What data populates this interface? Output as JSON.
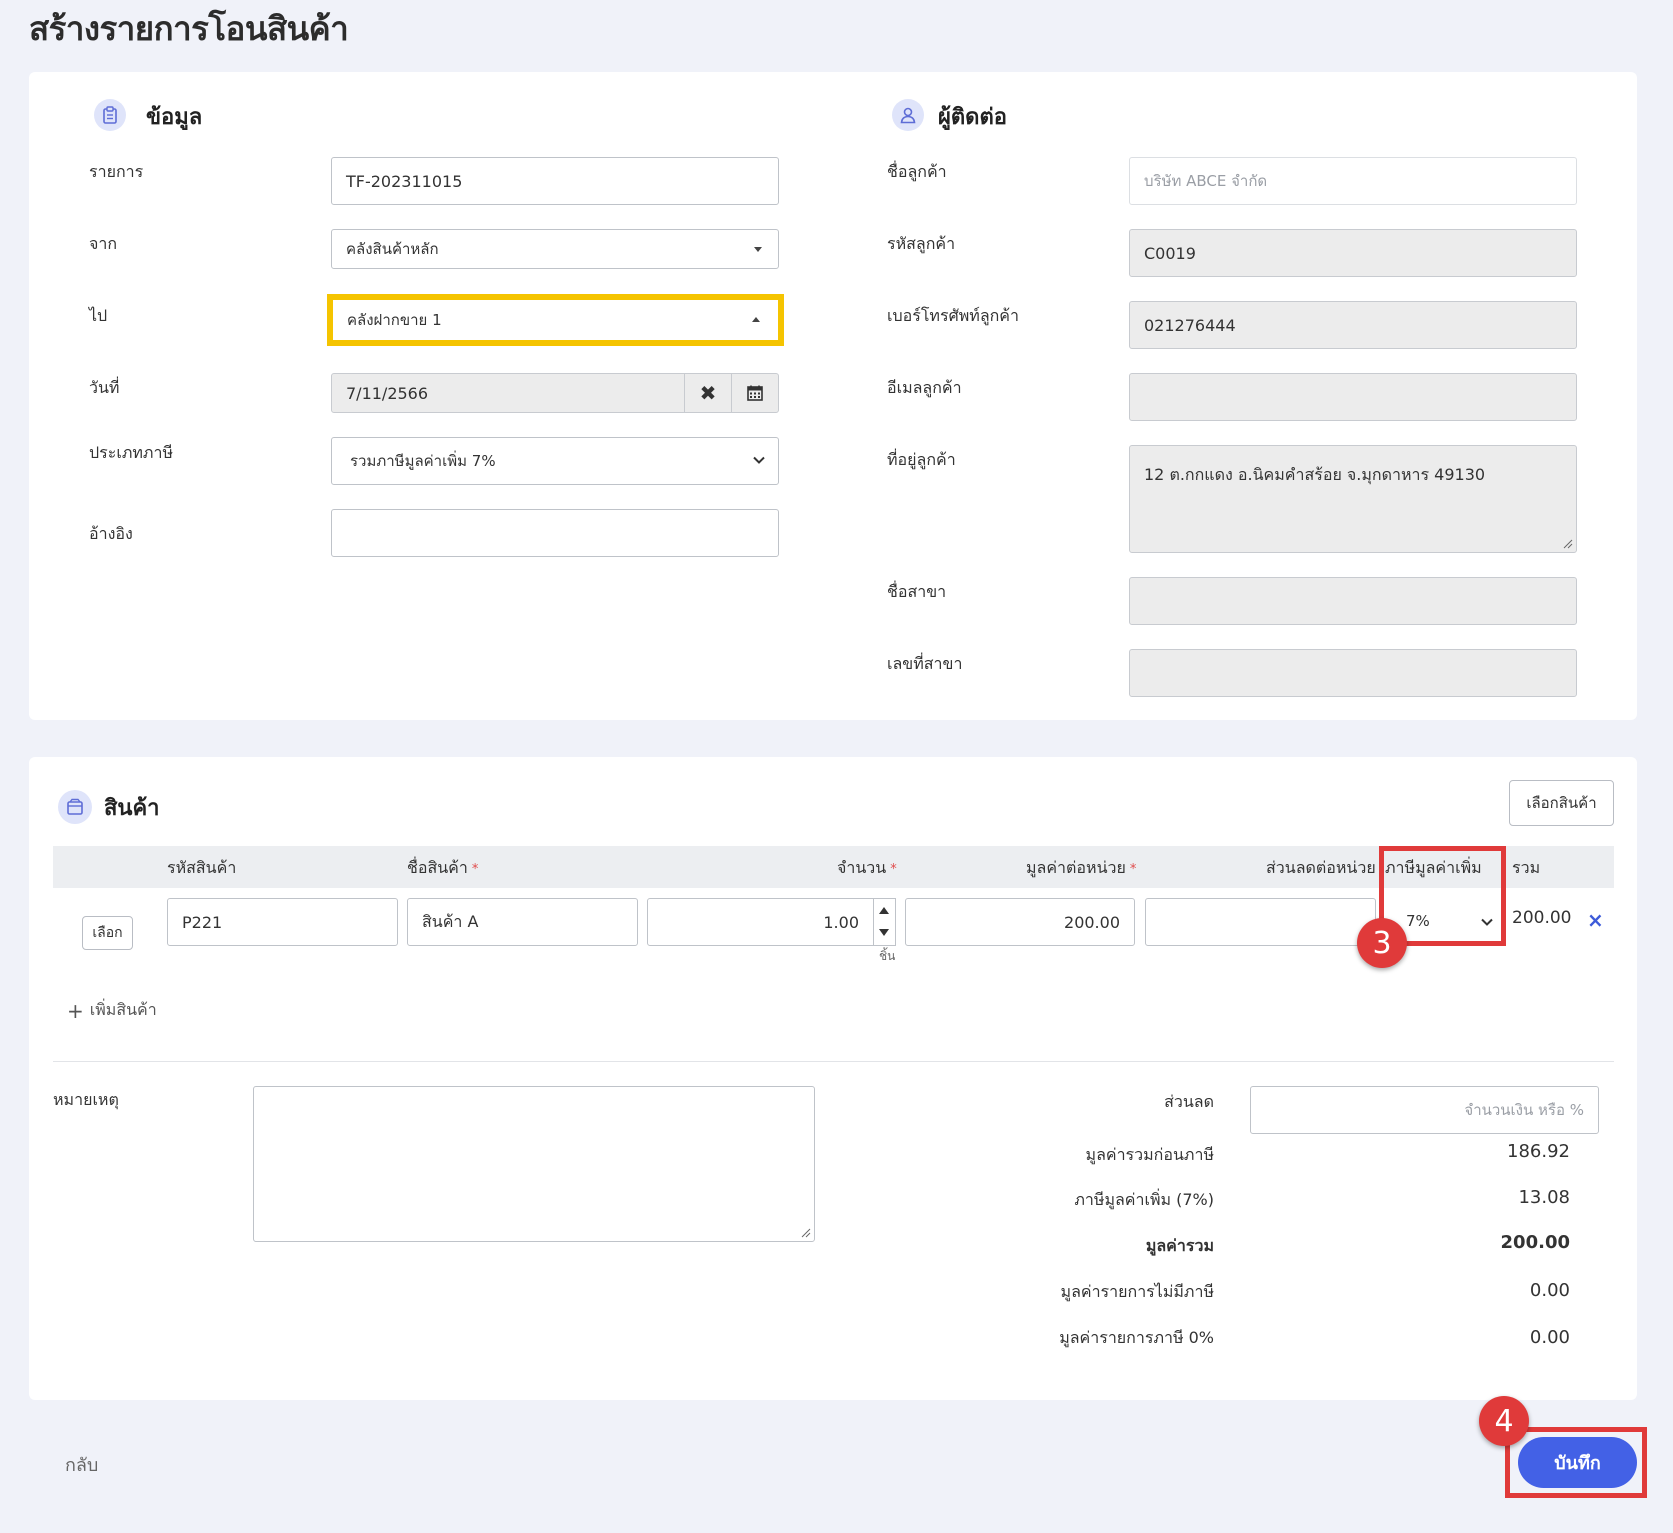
{
  "page": {
    "title": "สร้างรายการโอนสินค้า"
  },
  "info": {
    "section_title": "ข้อมูล",
    "section_icon": "clipboard-icon",
    "fields": {
      "doc_no_label": "รายการ",
      "doc_no_value": "TF-202311015",
      "from_label": "จาก",
      "from_value": "คลังสินค้าหลัก",
      "to_label": "ไป",
      "to_value": "คลังฝากขาย 1",
      "date_label": "วันที่",
      "date_value": "7/11/2566",
      "tax_type_label": "ประเภทภาษี",
      "tax_type_value": "รวมภาษีมูลค่าเพิ่ม 7%",
      "reference_label": "อ้างอิง",
      "reference_value": ""
    }
  },
  "contact": {
    "section_title": "ผู้ติดต่อ",
    "section_icon": "user-icon",
    "fields": {
      "customer_name_label": "ชื่อลูกค้า",
      "customer_name_placeholder": "บริษัท ABCE จำกัด",
      "customer_code_label": "รหัสลูกค้า",
      "customer_code_value": "C0019",
      "phone_label": "เบอร์โทรศัพท์ลูกค้า",
      "phone_value": "021276444",
      "email_label": "อีเมลลูกค้า",
      "email_value": "",
      "address_label": "ที่อยู่ลูกค้า",
      "address_value": "12 ต.กกแดง อ.นิคมคำสร้อย จ.มุกดาหาร 49130",
      "branch_name_label": "ชื่อสาขา",
      "branch_name_value": "",
      "branch_no_label": "เลขที่สาขา",
      "branch_no_value": ""
    }
  },
  "products": {
    "section_title": "สินค้า",
    "section_icon": "box-icon",
    "select_products_button": "เลือกสินค้า",
    "columns": {
      "code": "รหัสสินค้า",
      "name": "ชื่อสินค้า",
      "qty": "จำนวน",
      "unit_price": "มูลค่าต่อหน่วย",
      "discount": "ส่วนลดต่อหน่วย",
      "vat": "ภาษีมูลค่าเพิ่ม",
      "total": "รวม"
    },
    "required_mark": "*",
    "rows": [
      {
        "select_label": "เลือก",
        "code": "P221",
        "name": "สินค้า A",
        "qty": "1.00",
        "unit": "ชิ้น",
        "unit_price": "200.00",
        "discount": "",
        "vat": "7%",
        "total": "200.00"
      }
    ],
    "add_product_label": "เพิ่มสินค้า"
  },
  "notes": {
    "label": "หมายเหตุ",
    "value": ""
  },
  "summary": {
    "discount_label": "ส่วนลด",
    "discount_placeholder": "จำนวนเงิน หรือ %",
    "subtotal_label": "มูลค่ารวมก่อนภาษี",
    "subtotal_value": "186.92",
    "vat_label": "ภาษีมูลค่าเพิ่ม (7%)",
    "vat_value": "13.08",
    "grand_total_label": "มูลค่ารวม",
    "grand_total_value": "200.00",
    "non_taxable_label": "มูลค่ารายการไม่มีภาษี",
    "non_taxable_value": "0.00",
    "zero_tax_label": "มูลค่ารายการภาษี 0%",
    "zero_tax_value": "0.00"
  },
  "footer": {
    "back_label": "กลับ",
    "save_label": "บันทึก"
  },
  "annotations": {
    "step3": "3",
    "step4": "4"
  },
  "colors": {
    "accent": "#4361e6",
    "highlight_yellow": "#f5c400",
    "annotation_red": "#e03a3a"
  }
}
